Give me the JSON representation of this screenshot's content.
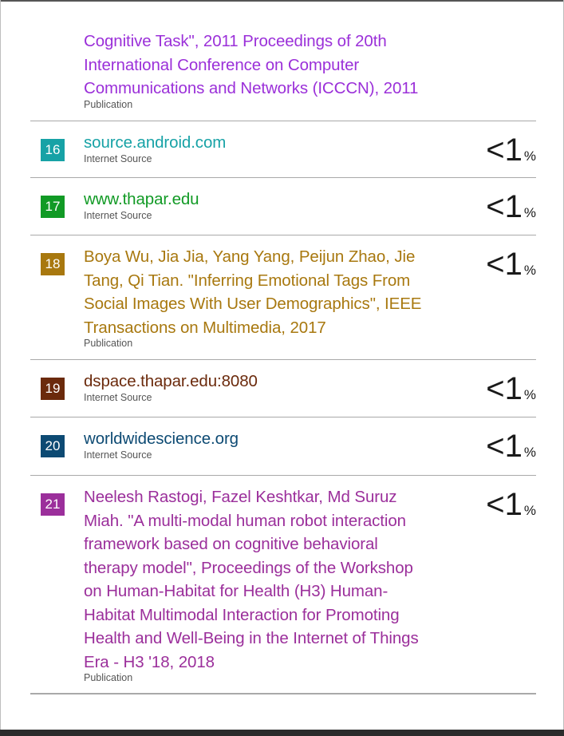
{
  "continuation": {
    "lines": [
      "Cognitive Task\", 2011 Proceedings of 20th",
      "International Conference on Computer",
      "Communications and Networks (ICCCN), 2011"
    ],
    "source_type": "Publication",
    "color": "#9b30d9"
  },
  "sources": [
    {
      "number": "16",
      "lines": [
        "source.android.com"
      ],
      "source_type": "Internet Source",
      "percent": "<1",
      "percent_sign": "%",
      "color": "#17a2a6"
    },
    {
      "number": "17",
      "lines": [
        "www.thapar.edu"
      ],
      "source_type": "Internet Source",
      "percent": "<1",
      "percent_sign": "%",
      "color": "#119a25"
    },
    {
      "number": "18",
      "lines": [
        "Boya Wu, Jia Jia, Yang Yang, Peijun Zhao, Jie",
        "Tang, Qi Tian. \"Inferring Emotional Tags From",
        "Social Images With User Demographics\", IEEE",
        "Transactions on Multimedia, 2017"
      ],
      "source_type": "Publication",
      "percent": "<1",
      "percent_sign": "%",
      "color": "#a8780f"
    },
    {
      "number": "19",
      "lines": [
        "dspace.thapar.edu:8080"
      ],
      "source_type": "Internet Source",
      "percent": "<1",
      "percent_sign": "%",
      "color": "#6b2a0c"
    },
    {
      "number": "20",
      "lines": [
        "worldwidescience.org"
      ],
      "source_type": "Internet Source",
      "percent": "<1",
      "percent_sign": "%",
      "color": "#0d4a73"
    },
    {
      "number": "21",
      "lines": [
        "Neelesh Rastogi, Fazel Keshtkar, Md Suruz",
        "Miah. \"A multi-modal human robot interaction",
        "framework based on cognitive behavioral",
        "therapy model\", Proceedings of the Workshop",
        "on Human-Habitat for Health (H3) Human-",
        "Habitat Multimodal Interaction for Promoting",
        "Health and Well-Being in the Internet of Things",
        "Era - H3 '18, 2018"
      ],
      "source_type": "Publication",
      "percent": "<1",
      "percent_sign": "%",
      "color": "#9b2f9b"
    }
  ]
}
